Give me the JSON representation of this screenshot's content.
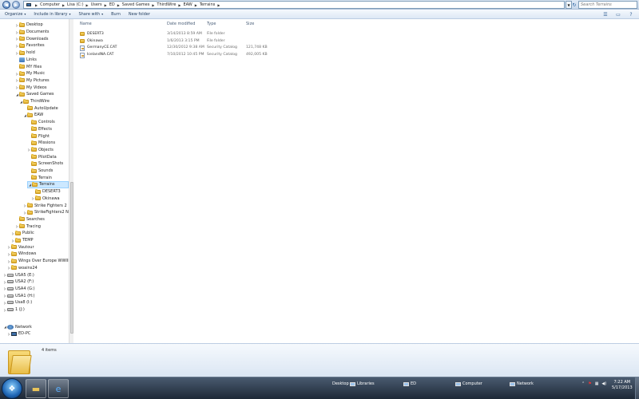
{
  "address": {
    "crumbs": [
      "Computer",
      "Lisa (C:)",
      "Users",
      "ED",
      "Saved Games",
      "ThirdWire",
      "EAW",
      "Terrains"
    ],
    "search_placeholder": "Search Terrains"
  },
  "toolbar": {
    "organize": "Organize",
    "include": "Include in library",
    "share": "Share with",
    "burn": "Burn",
    "new_folder": "New folder"
  },
  "nav_tree": [
    {
      "label": "Desktop",
      "level": 3,
      "exp": "right",
      "icon": "folder"
    },
    {
      "label": "Documents",
      "level": 3,
      "exp": "right",
      "icon": "folder"
    },
    {
      "label": "Downloads",
      "level": 3,
      "exp": "right",
      "icon": "folder"
    },
    {
      "label": "Favorites",
      "level": 3,
      "exp": "right",
      "icon": "folder"
    },
    {
      "label": "hold",
      "level": 3,
      "exp": "right",
      "icon": "folder"
    },
    {
      "label": "Links",
      "level": 3,
      "exp": "",
      "icon": "link"
    },
    {
      "label": "MY files",
      "level": 3,
      "exp": "",
      "icon": "folder"
    },
    {
      "label": "My Music",
      "level": 3,
      "exp": "right",
      "icon": "folder"
    },
    {
      "label": "My Pictures",
      "level": 3,
      "exp": "right",
      "icon": "folder"
    },
    {
      "label": "My Videos",
      "level": 3,
      "exp": "right",
      "icon": "folder"
    },
    {
      "label": "Saved Games",
      "level": 3,
      "exp": "down",
      "icon": "folder"
    },
    {
      "label": "ThirdWire",
      "level": 4,
      "exp": "down",
      "icon": "folder"
    },
    {
      "label": "AutoUpdate",
      "level": 5,
      "exp": "",
      "icon": "folder"
    },
    {
      "label": "EAW",
      "level": 5,
      "exp": "down",
      "icon": "folder"
    },
    {
      "label": "Controls",
      "level": 6,
      "exp": "",
      "icon": "folder"
    },
    {
      "label": "Effects",
      "level": 6,
      "exp": "",
      "icon": "folder"
    },
    {
      "label": "Flight",
      "level": 6,
      "exp": "",
      "icon": "folder"
    },
    {
      "label": "Missions",
      "level": 6,
      "exp": "",
      "icon": "folder"
    },
    {
      "label": "Objects",
      "level": 6,
      "exp": "right",
      "icon": "folder"
    },
    {
      "label": "PilotData",
      "level": 6,
      "exp": "",
      "icon": "folder"
    },
    {
      "label": "ScreenShots",
      "level": 6,
      "exp": "",
      "icon": "folder"
    },
    {
      "label": "Sounds",
      "level": 6,
      "exp": "",
      "icon": "folder"
    },
    {
      "label": "Terrain",
      "level": 6,
      "exp": "",
      "icon": "folder"
    },
    {
      "label": "Terrains",
      "level": 6,
      "exp": "down",
      "icon": "folder",
      "selected": true
    },
    {
      "label": "DESERT3",
      "level": 7,
      "exp": "",
      "icon": "folder"
    },
    {
      "label": "Okinawa",
      "level": 7,
      "exp": "right",
      "icon": "folder"
    },
    {
      "label": "Strike Fighters 2",
      "level": 5,
      "exp": "right",
      "icon": "folder"
    },
    {
      "label": "StrikeFighters2 Nor",
      "level": 5,
      "exp": "right",
      "icon": "folder"
    },
    {
      "label": "Searches",
      "level": 3,
      "exp": "",
      "icon": "folder"
    },
    {
      "label": "Tracing",
      "level": 3,
      "exp": "right",
      "icon": "folder"
    },
    {
      "label": "Public",
      "level": 2,
      "exp": "right",
      "icon": "folder"
    },
    {
      "label": "TEMP",
      "level": 2,
      "exp": "right",
      "icon": "folder"
    },
    {
      "label": "Vautour",
      "level": 1,
      "exp": "right",
      "icon": "folder"
    },
    {
      "label": "Windows",
      "level": 1,
      "exp": "right",
      "icon": "folder"
    },
    {
      "label": "Wings Over Europe WWIII",
      "level": 1,
      "exp": "right",
      "icon": "folder"
    },
    {
      "label": "woains24",
      "level": 1,
      "exp": "right",
      "icon": "folder"
    },
    {
      "label": "USA5 (E:)",
      "level": 0,
      "exp": "right",
      "icon": "drive"
    },
    {
      "label": "USA2 (F:)",
      "level": 0,
      "exp": "right",
      "icon": "drive"
    },
    {
      "label": "USA4 (G:)",
      "level": 0,
      "exp": "right",
      "icon": "drive"
    },
    {
      "label": "USA1 (H:)",
      "level": 0,
      "exp": "right",
      "icon": "drive"
    },
    {
      "label": "Usa8 (I:)",
      "level": 0,
      "exp": "right",
      "icon": "drive"
    },
    {
      "label": "1 (J:)",
      "level": 0,
      "exp": "right",
      "icon": "drive"
    }
  ],
  "network": [
    {
      "label": "Network",
      "level": 0,
      "exp": "down",
      "icon": "network"
    },
    {
      "label": "ED-PC",
      "level": 1,
      "exp": "right",
      "icon": "pc"
    }
  ],
  "columns": {
    "name": "Name",
    "date": "Date modified",
    "type": "Type",
    "size": "Size"
  },
  "files": [
    {
      "name": "DESERT3",
      "date": "3/14/2013 8:59 AM",
      "type": "File folder",
      "size": "",
      "icon": "folder"
    },
    {
      "name": "Okinawa",
      "date": "1/6/2013 3:15 PM",
      "type": "File folder",
      "size": "",
      "icon": "folder"
    },
    {
      "name": "GermanyCE.CAT",
      "date": "12/30/2012 9:38 AM",
      "type": "Security Catalog",
      "size": "121,748 KB",
      "icon": "cat"
    },
    {
      "name": "IcelandNA.CAT",
      "date": "7/10/2012 10:45 PM",
      "type": "Security Catalog",
      "size": "492,005 KB",
      "icon": "cat"
    }
  ],
  "details": {
    "count": "4 items"
  },
  "taskbar": {
    "desktop": "Desktop",
    "libraries": "Libraries",
    "ed": "ED",
    "computer": "Computer",
    "network": "Network",
    "time": "7:22 AM",
    "date": "5/17/2013"
  }
}
